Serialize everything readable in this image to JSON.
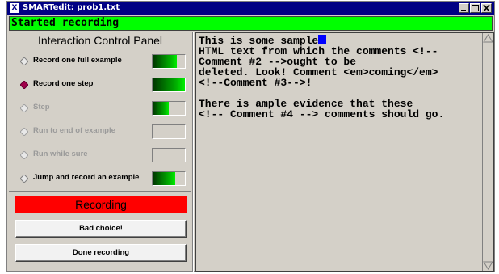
{
  "window": {
    "title": "SMARTedit: prob1.txt",
    "app_icon": "X"
  },
  "status": {
    "text": "Started recording",
    "color": "#00ff00"
  },
  "panel": {
    "title": "Interaction Control Panel",
    "controls": [
      {
        "label": "Record one full example",
        "enabled": true,
        "selected": false,
        "meter_fraction": 0.75
      },
      {
        "label": "Record one step",
        "enabled": true,
        "selected": true,
        "meter_fraction": 1.0
      },
      {
        "label": "Step",
        "enabled": false,
        "selected": false,
        "meter_fraction": 0.5
      },
      {
        "label": "Run to end of example",
        "enabled": false,
        "selected": false,
        "meter_fraction": 0.0
      },
      {
        "label": "Run while sure",
        "enabled": false,
        "selected": false,
        "meter_fraction": 0.0
      },
      {
        "label": "Jump and record an example",
        "enabled": true,
        "selected": false,
        "meter_fraction": 0.7
      }
    ],
    "recording_label": "Recording",
    "recording_color": "#ff0000",
    "bad_choice_label": "Bad choice!",
    "done_recording_label": "Done recording"
  },
  "editor": {
    "before_cursor": "This is some sample",
    "after_cursor": "\nHTML text from which the comments <!--\nComment #2 -->ought to be\ndeleted. Look! Comment <em>coming</em>\n<!--Comment #3-->!\n\nThere is ample evidence that these\n<!-- Comment #4 --> comments should go.",
    "cursor_color": "#0000ff"
  }
}
